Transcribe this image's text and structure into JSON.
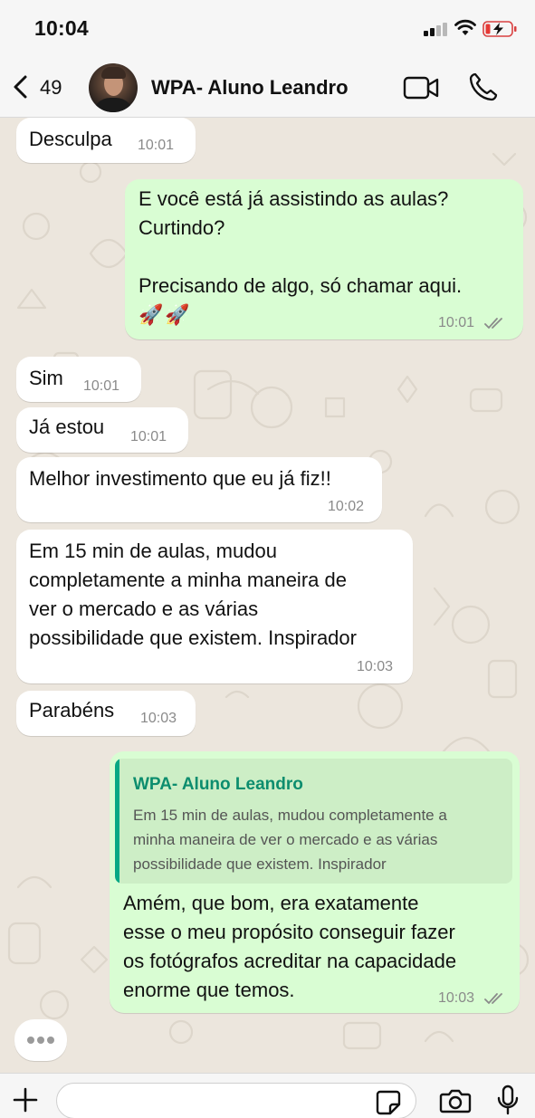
{
  "status_bar": {
    "time": "10:04",
    "battery_state": "charging-low"
  },
  "header": {
    "back_count": "49",
    "title": "WPA- Aluno Leandro"
  },
  "colors": {
    "incoming_bubble": "#ffffff",
    "outgoing_bubble": "#d9fdd3",
    "quote_accent": "#06a884",
    "chat_background": "#ece6dd"
  },
  "messages": [
    {
      "direction": "in",
      "lines": [
        "Desculpa"
      ],
      "time": "10:01"
    },
    {
      "direction": "out",
      "lines": [
        "E você está já assistindo as aulas?",
        "Curtindo?",
        "",
        "Precisando de algo, só chamar aqui.",
        "🚀🚀"
      ],
      "time": "10:01",
      "status": "read"
    },
    {
      "direction": "in",
      "lines": [
        "Sim"
      ],
      "time": "10:01"
    },
    {
      "direction": "in",
      "lines": [
        "Já estou"
      ],
      "time": "10:01"
    },
    {
      "direction": "in",
      "lines": [
        "Melhor investimento que eu já fiz!!"
      ],
      "time": "10:02"
    },
    {
      "direction": "in",
      "lines": [
        "Em 15 min de aulas, mudou",
        "completamente a minha maneira de",
        "ver o mercado e as várias",
        "possibilidade que existem. Inspirador"
      ],
      "time": "10:03"
    },
    {
      "direction": "in",
      "lines": [
        "Parabéns"
      ],
      "time": "10:03"
    },
    {
      "direction": "out",
      "quote": {
        "author": "WPA- Aluno Leandro",
        "lines": [
          "Em 15 min de aulas, mudou completamente a",
          "minha maneira de ver o mercado e as várias",
          "possibilidade que existem. Inspirador"
        ]
      },
      "lines": [
        "Amém, que bom, era exatamente",
        "esse o meu propósito conseguir fazer",
        "os fotógrafos acreditar na capacidade",
        "enorme que temos."
      ],
      "time": "10:03",
      "status": "read"
    }
  ],
  "input": {
    "value": "",
    "placeholder": ""
  },
  "icons": {
    "back": "chevron-left-icon",
    "video": "video-camera-icon",
    "phone": "phone-icon",
    "plus": "plus-icon",
    "sticker": "sticker-icon",
    "camera": "camera-icon",
    "mic": "microphone-icon"
  }
}
